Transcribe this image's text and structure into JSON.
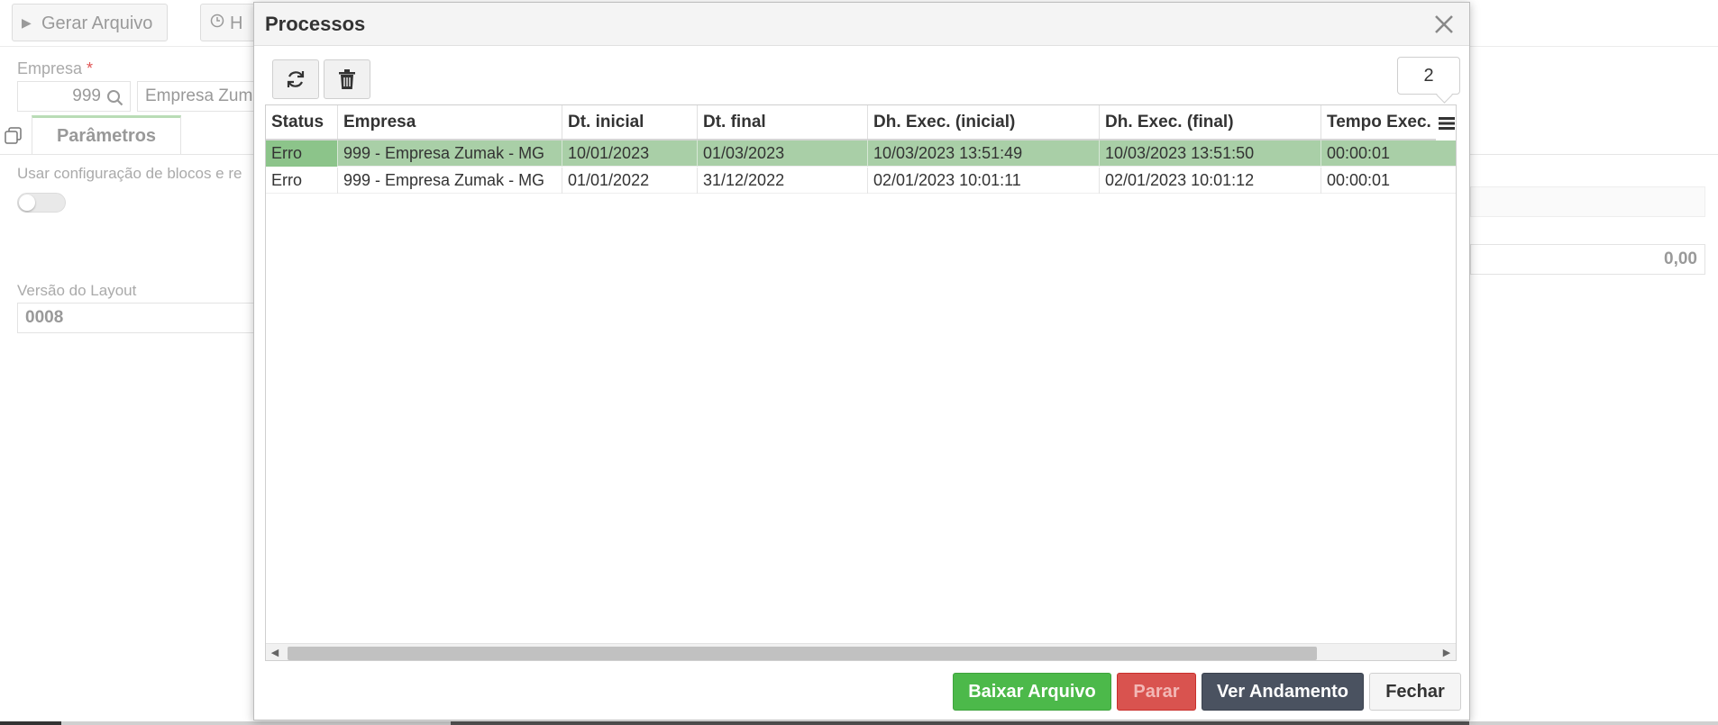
{
  "background": {
    "toolbar": {
      "gerar_arquivo": "Gerar Arquivo",
      "historico_partial": "H"
    },
    "empresa_label": "Empresa",
    "required_mark": "*",
    "empresa_code": "999",
    "empresa_name_partial": "Empresa Zum",
    "tab_parametros": "Parâmetros",
    "usar_config_partial": "Usar configuração de blocos e re",
    "versao_label": "Versão do Layout",
    "versao_value": "0008",
    "right_value": "0,00"
  },
  "modal": {
    "title": "Processos",
    "count": "2",
    "grid": {
      "columns": [
        "Status",
        "Empresa",
        "Dt. inicial",
        "Dt. final",
        "Dh. Exec. (inicial)",
        "Dh. Exec. (final)",
        "Tempo Exec."
      ],
      "rows": [
        [
          "Erro",
          "999 - Empresa Zumak - MG",
          "10/01/2023",
          "01/03/2023",
          "10/03/2023 13:51:49",
          "10/03/2023 13:51:50",
          "00:00:01"
        ],
        [
          "Erro",
          "999 - Empresa Zumak - MG",
          "01/01/2022",
          "31/12/2022",
          "02/01/2023 10:01:11",
          "02/01/2023 10:01:12",
          "00:00:01"
        ]
      ]
    },
    "buttons": {
      "baixar": "Baixar Arquivo",
      "parar": "Parar",
      "ver_andamento": "Ver Andamento",
      "fechar": "Fechar"
    }
  },
  "colors": {
    "selected_row": "#a9cfa7",
    "primary_green": "#4cb94a",
    "danger_red": "#d9534f",
    "dark": "#4a5260"
  }
}
